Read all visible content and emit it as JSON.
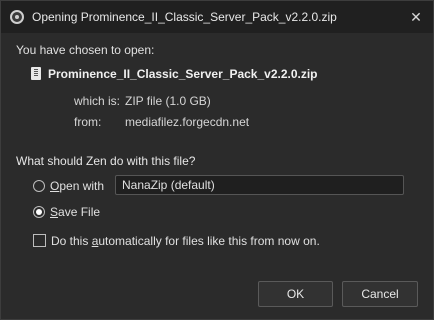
{
  "window": {
    "title": "Opening Prominence_II_Classic_Server_Pack_v2.2.0.zip",
    "close_glyph": "✕",
    "app_icon": "zen-browser-icon"
  },
  "dialog": {
    "chosen_text": "You have chosen to open:",
    "file_icon": "document-icon",
    "filename": "Prominence_II_Classic_Server_Pack_v2.2.0.zip",
    "which_is_label": "which is:",
    "which_is_value": "ZIP file (1.0 GB)",
    "from_label": "from:",
    "from_value": "mediafilez.forgecdn.net",
    "question": "What should Zen do with this file?",
    "open_with": {
      "accel": "O",
      "rest": "pen with",
      "selected": false,
      "app": "NanaZip (default)"
    },
    "save_file": {
      "accel": "S",
      "rest": "ave File",
      "selected": true
    },
    "auto_checkbox": {
      "checked": false,
      "label_pre": "Do this ",
      "accel": "a",
      "label_post": "utomatically for files like this from now on."
    },
    "buttons": {
      "ok": "OK",
      "cancel": "Cancel"
    }
  }
}
